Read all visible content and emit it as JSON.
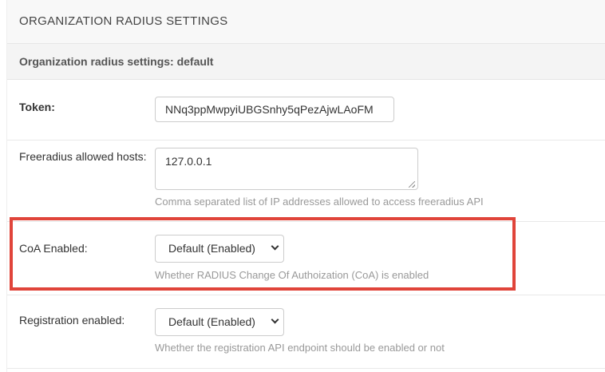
{
  "module": {
    "title": "ORGANIZATION RADIUS SETTINGS",
    "subheader": "Organization radius settings: default"
  },
  "fields": {
    "token": {
      "label": "Token:",
      "value": "NNq3ppMwpyiUBGSnhy5qPezAjwLAoFM"
    },
    "freeradius_hosts": {
      "label": "Freeradius allowed hosts:",
      "value": "127.0.0.1",
      "help": "Comma separated list of IP addresses allowed to access freeradius API"
    },
    "coa_enabled": {
      "label": "CoA Enabled:",
      "selected": "Default (Enabled)",
      "help": "Whether RADIUS Change Of Authoization (CoA) is enabled"
    },
    "registration_enabled": {
      "label": "Registration enabled:",
      "selected": "Default (Enabled)",
      "help": "Whether the registration API endpoint should be enabled or not"
    }
  },
  "colors": {
    "highlight": "#e0443a"
  }
}
